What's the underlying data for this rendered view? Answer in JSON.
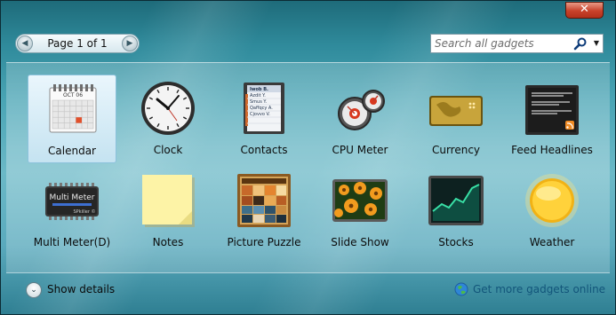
{
  "window": {
    "close_glyph": "✕"
  },
  "pager": {
    "label": "Page 1 of 1",
    "prev_glyph": "◀",
    "next_glyph": "▶"
  },
  "search": {
    "placeholder": "Search all gadgets",
    "dropdown_glyph": "▼"
  },
  "gadgets": [
    {
      "label": "Calendar",
      "icon": "calendar-icon",
      "selected": true,
      "month": "OCT 06"
    },
    {
      "label": "Clock",
      "icon": "clock-icon",
      "selected": false
    },
    {
      "label": "Contacts",
      "icon": "contacts-icon",
      "selected": false
    },
    {
      "label": "CPU Meter",
      "icon": "cpu-meter-icon",
      "selected": false
    },
    {
      "label": "Currency",
      "icon": "currency-icon",
      "selected": false
    },
    {
      "label": "Feed Headlines",
      "icon": "feed-headlines-icon",
      "selected": false
    },
    {
      "label": "Multi Meter(D)",
      "icon": "multi-meter-icon",
      "selected": false,
      "chip_title": "Multi Meter",
      "chip_sub": "SPkiller ©"
    },
    {
      "label": "Notes",
      "icon": "notes-icon",
      "selected": false
    },
    {
      "label": "Picture Puzzle",
      "icon": "picture-puzzle-icon",
      "selected": false
    },
    {
      "label": "Slide Show",
      "icon": "slide-show-icon",
      "selected": false
    },
    {
      "label": "Stocks",
      "icon": "stocks-icon",
      "selected": false
    },
    {
      "label": "Weather",
      "icon": "weather-icon",
      "selected": false
    }
  ],
  "contacts_names": [
    "Iwob B.",
    "Azdit Y.",
    "Smus Y.",
    "Qaffqcy A.",
    "Cjovvo V."
  ],
  "footer": {
    "show_details": "Show details",
    "show_details_glyph": "⌄",
    "get_more": "Get more gadgets online"
  },
  "colors": {
    "accent_link": "#12557a",
    "close_red": "#c8412a",
    "selection": "#c5e3f1"
  }
}
